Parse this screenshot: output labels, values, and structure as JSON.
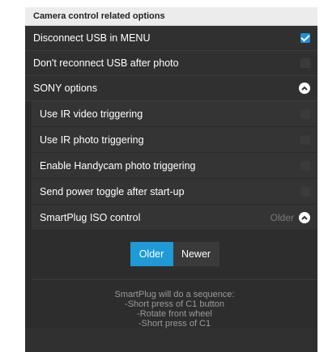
{
  "panel": {
    "header": "Camera control related options",
    "rows": [
      {
        "label": "Disconnect USB in MENU",
        "checked": true
      },
      {
        "label": "Don't reconnect USB after photo",
        "checked": false
      }
    ],
    "sony": {
      "label": "SONY options",
      "expanded": true,
      "rows": [
        {
          "label": "Use IR video triggering",
          "checked": false
        },
        {
          "label": "Use IR photo triggering",
          "checked": false
        },
        {
          "label": "Enable Handycam photo triggering",
          "checked": false
        },
        {
          "label": "Send power toggle after start-up",
          "checked": false
        }
      ],
      "smartplug": {
        "label": "SmartPlug ISO control",
        "selected": "Older",
        "options": [
          "Older",
          "Newer"
        ],
        "description": [
          "SmartPlug will do a sequence:",
          "-Short press of C1 button",
          "-Rotate front wheel",
          "-Short press of C1"
        ]
      }
    }
  },
  "colors": {
    "accent": "#1e9ad6",
    "panel_bg": "#303030",
    "header_bg": "#ececec"
  }
}
